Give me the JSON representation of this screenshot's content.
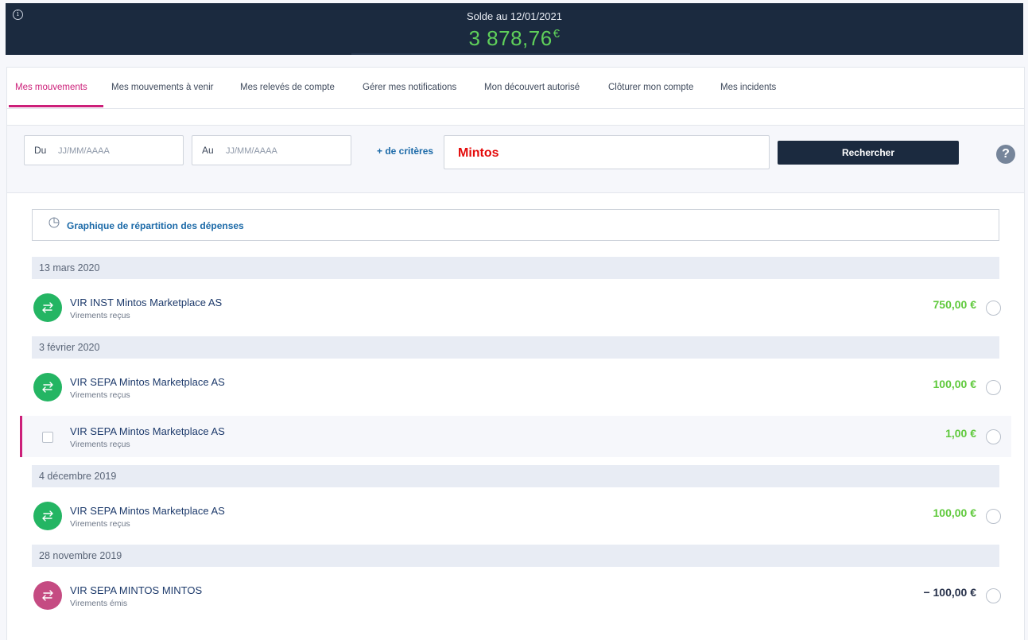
{
  "header": {
    "balance_label": "Solde au 12/01/2021",
    "balance_amount": "3 878,76",
    "currency": "€",
    "info_icon": "info-icon"
  },
  "tabs": [
    {
      "label": "Mes mouvements",
      "active": true
    },
    {
      "label": "Mes mouvements à venir"
    },
    {
      "label": "Mes relevés de compte"
    },
    {
      "label": "Gérer mes notifications"
    },
    {
      "label": "Mon découvert autorisé"
    },
    {
      "label": "Clôturer mon compte"
    },
    {
      "label": "Mes incidents"
    }
  ],
  "filters": {
    "from_label": "Du",
    "from_placeholder": "JJ/MM/AAAA",
    "to_label": "Au",
    "to_placeholder": "JJ/MM/AAAA",
    "more_criteria": "+ de critères",
    "search_value": "Mintos",
    "search_button": "Rechercher",
    "help": "?"
  },
  "graph_link": {
    "label": "Graphique de répartition des dépenses",
    "icon": "pie-chart-icon"
  },
  "groups": [
    {
      "date": "13 mars 2020",
      "transactions": [
        {
          "title": "VIR INST Mintos Marketplace AS",
          "category": "Virements reçus",
          "amount": "750,00 €",
          "direction": "in"
        }
      ]
    },
    {
      "date": "3 février 2020",
      "transactions": [
        {
          "title": "VIR SEPA Mintos Marketplace AS",
          "category": "Virements reçus",
          "amount": "100,00 €",
          "direction": "in"
        },
        {
          "title": "VIR SEPA Mintos Marketplace AS",
          "category": "Virements reçus",
          "amount": "1,00 €",
          "direction": "in",
          "selected": true
        }
      ]
    },
    {
      "date": "4 décembre 2019",
      "transactions": [
        {
          "title": "VIR SEPA Mintos Marketplace AS",
          "category": "Virements reçus",
          "amount": "100,00 €",
          "direction": "in"
        }
      ]
    },
    {
      "date": "28 novembre 2019",
      "transactions": [
        {
          "title": "VIR SEPA MINTOS MINTOS",
          "category": "Virements émis",
          "amount": "− 100,00 €",
          "direction": "out"
        }
      ]
    }
  ],
  "colors": {
    "banner": "#1b2a3f",
    "accent": "#cc1f79",
    "positive": "#5fc93c",
    "incoming_icon": "#24b563",
    "outgoing_icon": "#c54b82",
    "link": "#1c6aa8"
  }
}
